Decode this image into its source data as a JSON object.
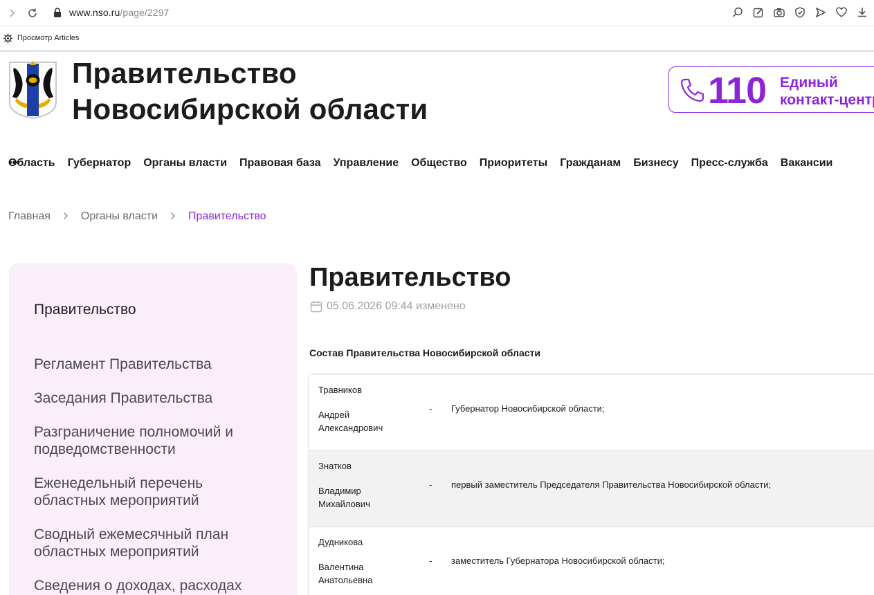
{
  "browser": {
    "url_host": "www.nso.ru",
    "url_path": "/page/2297",
    "extension_label": "Просмотр Articles"
  },
  "header": {
    "title_line1": "Правительство",
    "title_line2": "Новосибирской области",
    "hotline_number": "110",
    "hotline_label_line1": "Единый",
    "hotline_label_line2": "контакт-центр"
  },
  "nav": {
    "items": [
      "Область",
      "Губернатор",
      "Органы власти",
      "Правовая база",
      "Управление",
      "Общество",
      "Приоритеты",
      "Гражданам",
      "Бизнесу",
      "Пресс-служба",
      "Вакансии"
    ],
    "more": "•••"
  },
  "breadcrumbs": [
    "Главная",
    "Органы власти",
    "Правительство"
  ],
  "sidebar": {
    "title": "Правительство",
    "items": [
      "Регламент Правительства",
      "Заседания Правительства",
      "Разграничение полномочий и подведомственности",
      "Еженедельный перечень областных мероприятий",
      "Сводный ежемесячный план областных мероприятий",
      "Сведения о доходах, расходах"
    ]
  },
  "content": {
    "title": "Правительство",
    "date": "05.06.2026 09:44 изменено",
    "section_title": "Состав Правительства Новосибирской области",
    "members": [
      {
        "surname": "Травников",
        "given": "Андрей Александрович",
        "dash": "-",
        "role": "Губернатор Новосибирской области;"
      },
      {
        "surname": "Знатков",
        "given": "Владимир Михайлович",
        "dash": "-",
        "role": "первый заместитель Председателя Правительства Новосибирской области;"
      },
      {
        "surname": "Дудникова",
        "given": "Валентина Анатольевна",
        "dash": "-",
        "role": "заместитель Губернатора Новосибирской области;"
      }
    ]
  },
  "colors": {
    "accent": "#8c25d6",
    "sidebar_bg": "#fbeefb",
    "row_alt_bg": "#f2f2f2"
  }
}
